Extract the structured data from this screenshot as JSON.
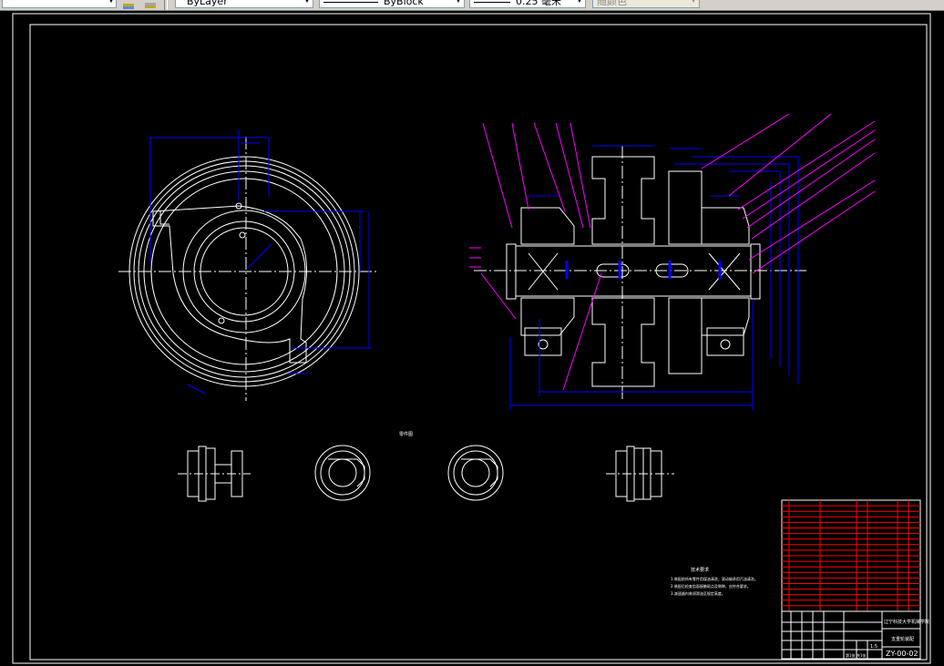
{
  "toolbar": {
    "color_control": {
      "value": ""
    },
    "layer_control": {
      "value": "ByLayer"
    },
    "linetype_control": {
      "value": "ByBlock"
    },
    "lineweight_control": {
      "value": "0.25 毫米"
    },
    "plotstyle_control": {
      "value": "随颜色"
    }
  },
  "drawing": {
    "view_label": "零件图",
    "tech_req_title": "技术要求",
    "tech_req_lines": [
      "1.装配前所有零件用煤油清洗，滚动轴承用汽油清洗。",
      "2.装配后检查齿面接触斑点及侧隙，应符合要求。",
      "3.减速器内装润滑油至规定高度。"
    ],
    "title_block": {
      "company": "辽宁科技大学机械学院",
      "drawing_name": "支重轮装配",
      "drawing_number": "ZY-00-02",
      "scale": "1:5",
      "sheet": "第1张 共1张"
    }
  },
  "colors": {
    "background": "#000000",
    "outline": "#ffffff",
    "dimension": "#0000ff",
    "leader": "#ff00ff",
    "table_red": "#ff0000",
    "centerline": "#ffffff"
  }
}
